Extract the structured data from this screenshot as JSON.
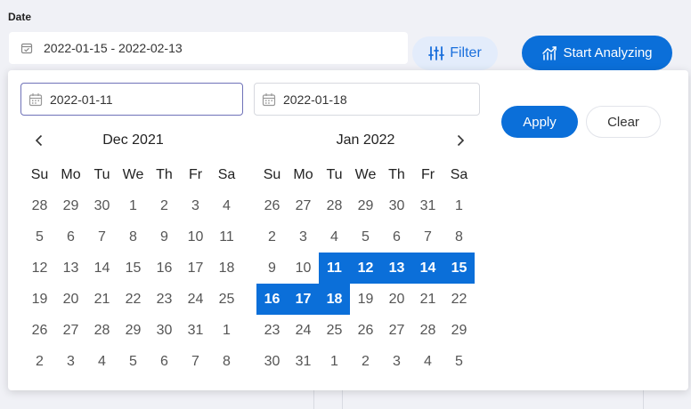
{
  "header": {
    "date_label": "Date",
    "range_value": "2022-01-15 - 2022-02-13",
    "filter_label": "Filter",
    "start_label": "Start Analyzing"
  },
  "picker": {
    "start_value": "2022-01-11",
    "end_value": "2022-01-18",
    "apply_label": "Apply",
    "clear_label": "Clear",
    "weekdays": [
      "Su",
      "Mo",
      "Tu",
      "We",
      "Th",
      "Fr",
      "Sa"
    ],
    "months": [
      {
        "title": "Dec 2021",
        "days": [
          "28",
          "29",
          "30",
          "1",
          "2",
          "3",
          "4",
          "5",
          "6",
          "7",
          "8",
          "9",
          "10",
          "11",
          "12",
          "13",
          "14",
          "15",
          "16",
          "17",
          "18",
          "19",
          "20",
          "21",
          "22",
          "23",
          "24",
          "25",
          "26",
          "27",
          "28",
          "29",
          "30",
          "31",
          "1",
          "2",
          "3",
          "4",
          "5",
          "6",
          "7",
          "8"
        ],
        "selected_indexes": []
      },
      {
        "title": "Jan 2022",
        "days": [
          "26",
          "27",
          "28",
          "29",
          "30",
          "31",
          "1",
          "2",
          "3",
          "4",
          "5",
          "6",
          "7",
          "8",
          "9",
          "10",
          "11",
          "12",
          "13",
          "14",
          "15",
          "16",
          "17",
          "18",
          "19",
          "20",
          "21",
          "22",
          "23",
          "24",
          "25",
          "26",
          "27",
          "28",
          "29",
          "30",
          "31",
          "1",
          "2",
          "3",
          "4",
          "5"
        ],
        "selected_indexes": [
          16,
          17,
          18,
          19,
          20,
          21,
          22,
          23
        ]
      }
    ]
  },
  "colors": {
    "accent": "#0b6fd9",
    "filter_bg": "#e3ecfb"
  }
}
